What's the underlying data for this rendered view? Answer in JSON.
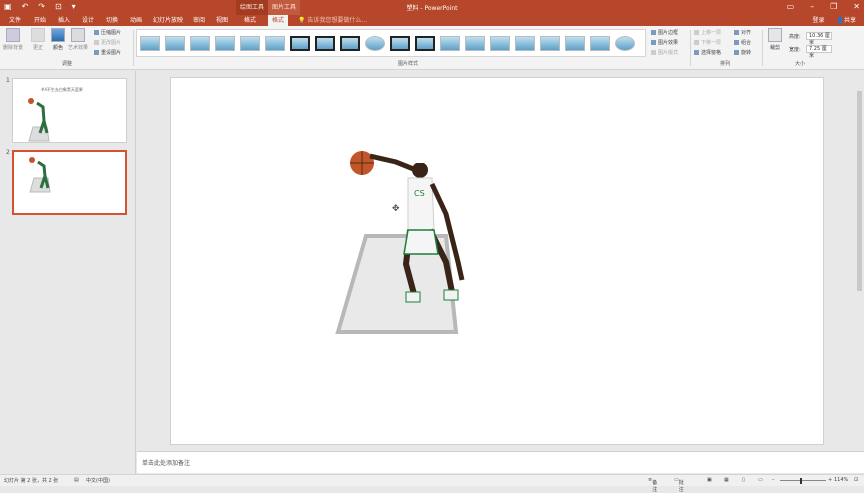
{
  "window": {
    "title": "塑料 - PowerPoint",
    "context_tools": [
      "绘图工具",
      "图片工具"
    ]
  },
  "tabs": [
    "文件",
    "开始",
    "插入",
    "设计",
    "切换",
    "动画",
    "幻灯片放映",
    "审阅",
    "视图",
    "格式",
    "格式"
  ],
  "active_tab": "格式",
  "tell_me": "告诉我您想要做什么...",
  "user": {
    "login": "登录",
    "share": "共享"
  },
  "ribbon": {
    "adjust": {
      "remove_bg": "删除背景",
      "correct": "更正",
      "color": "颜色",
      "artistic": "艺术效果",
      "compress": "压缩图片",
      "change": "更改图片",
      "reset": "重设图片",
      "label": "调整"
    },
    "styles": {
      "label": "图片样式",
      "border": "图片边框",
      "effects": "图片效果",
      "layout": "图片版式"
    },
    "arrange": {
      "label": "排列",
      "forward": "上移一层",
      "backward": "下移一层",
      "pane": "选择窗格",
      "align": "对齐",
      "group": "组合",
      "rotate": "旋转"
    },
    "size": {
      "label": "大小",
      "crop": "裁剪",
      "height_label": "高度:",
      "height": "10.36 厘米",
      "width_label": "宽度:",
      "width": "7.25 厘米"
    }
  },
  "slides": [
    {
      "number": "1",
      "caption": "#4不生去白象黑天篮果"
    },
    {
      "number": "2",
      "caption": ""
    }
  ],
  "notes_placeholder": "单击此处添加备注",
  "status": {
    "slide_info": "幻灯片 第 2 张，共 2 张",
    "language": "中文(中国)",
    "notes": "备注",
    "comments": "批注",
    "zoom": "114%"
  }
}
